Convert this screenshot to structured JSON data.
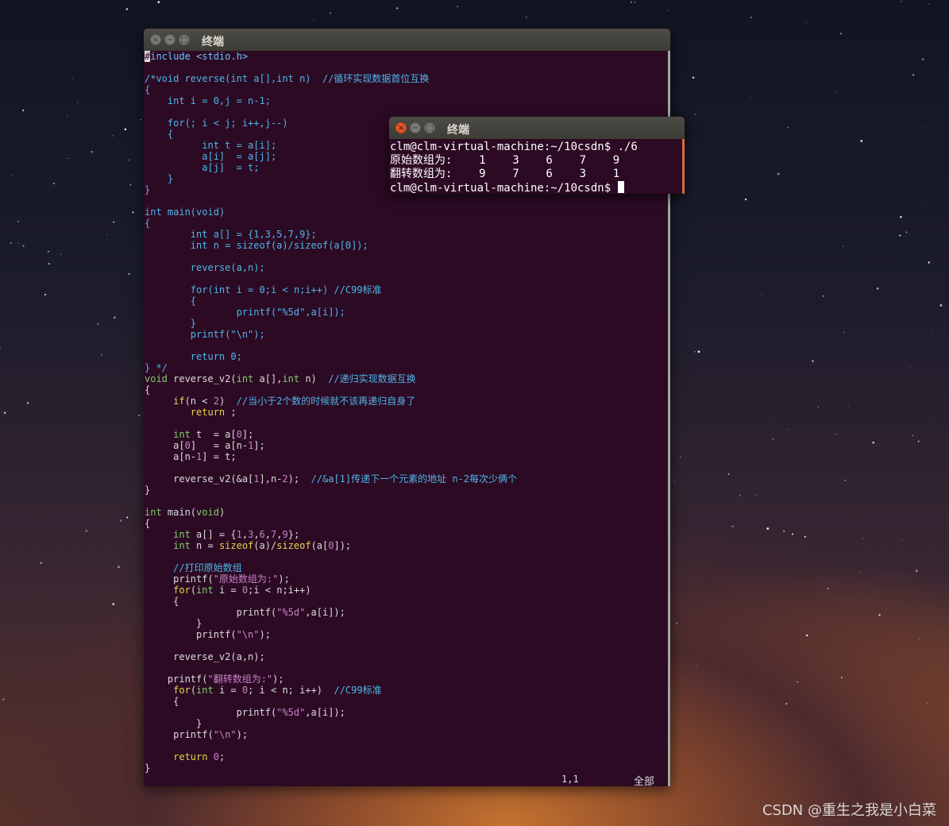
{
  "vim_window": {
    "title": "终端",
    "code_lines": [
      [
        {
          "t": "#include <stdio.h>",
          "c": "#66c2ff"
        }
      ],
      [],
      [
        {
          "t": "/*void reverse(int a[],int n)  //循环实现数据首位互换",
          "c": "#4fb5e8"
        }
      ],
      [
        {
          "t": "{",
          "c": "#4fb5e8"
        }
      ],
      [
        {
          "t": "    int i = 0,j = n-1;",
          "c": "#4fb5e8"
        }
      ],
      [],
      [
        {
          "t": "    for(; i < j; i++,j--)",
          "c": "#4fb5e8"
        }
      ],
      [
        {
          "t": "    {",
          "c": "#4fb5e8"
        }
      ],
      [
        {
          "t": "          int t = a[i];",
          "c": "#4fb5e8"
        }
      ],
      [
        {
          "t": "          a[i]  = a[j];",
          "c": "#4fb5e8"
        }
      ],
      [
        {
          "t": "          a[j]  = t;",
          "c": "#4fb5e8"
        }
      ],
      [
        {
          "t": "    }",
          "c": "#4fb5e8"
        }
      ],
      [
        {
          "t": "}",
          "c": "#4fb5e8"
        }
      ],
      [],
      [
        {
          "t": "int main(void)",
          "c": "#4fb5e8"
        }
      ],
      [
        {
          "t": "{",
          "c": "#4fb5e8"
        }
      ],
      [
        {
          "t": "        int a[] = {1,3,5,7,9};",
          "c": "#4fb5e8"
        }
      ],
      [
        {
          "t": "        int n = sizeof(a)/sizeof(a[0]);",
          "c": "#4fb5e8"
        }
      ],
      [],
      [
        {
          "t": "        reverse(a,n);",
          "c": "#4fb5e8"
        }
      ],
      [],
      [
        {
          "t": "        for(int i = 0;i < n;i++) //C99标准",
          "c": "#4fb5e8"
        }
      ],
      [
        {
          "t": "        {",
          "c": "#4fb5e8"
        }
      ],
      [
        {
          "t": "                printf(\"%5d\",a[i]);",
          "c": "#4fb5e8"
        }
      ],
      [
        {
          "t": "        }",
          "c": "#4fb5e8"
        }
      ],
      [
        {
          "t": "        printf(\"\\n\");",
          "c": "#4fb5e8"
        }
      ],
      [],
      [
        {
          "t": "        return 0;",
          "c": "#4fb5e8"
        }
      ],
      [
        {
          "t": "} */",
          "c": "#4fb5e8"
        }
      ],
      [
        {
          "t": "void ",
          "c": "#7fcf6a"
        },
        {
          "t": "reverse_v2(",
          "c": "#dcdcdc"
        },
        {
          "t": "int",
          "c": "#7fcf6a"
        },
        {
          "t": " a[],",
          "c": "#dcdcdc"
        },
        {
          "t": "int",
          "c": "#7fcf6a"
        },
        {
          "t": " n)  ",
          "c": "#dcdcdc"
        },
        {
          "t": "//递归实现数据互换",
          "c": "#4fb5e8"
        }
      ],
      [
        {
          "t": "{",
          "c": "#dcdcdc"
        }
      ],
      [
        {
          "t": "     ",
          "c": "#dcdcdc"
        },
        {
          "t": "if",
          "c": "#e8d44d"
        },
        {
          "t": "(n < ",
          "c": "#dcdcdc"
        },
        {
          "t": "2",
          "c": "#c783c7"
        },
        {
          "t": ")  ",
          "c": "#dcdcdc"
        },
        {
          "t": "//当小于2个数的时候就不该再递归自身了",
          "c": "#4fb5e8"
        }
      ],
      [
        {
          "t": "        ",
          "c": "#dcdcdc"
        },
        {
          "t": "return",
          "c": "#e8d44d"
        },
        {
          "t": " ;",
          "c": "#dcdcdc"
        }
      ],
      [],
      [
        {
          "t": "     ",
          "c": "#dcdcdc"
        },
        {
          "t": "int",
          "c": "#7fcf6a"
        },
        {
          "t": " t  = a[",
          "c": "#dcdcdc"
        },
        {
          "t": "0",
          "c": "#c783c7"
        },
        {
          "t": "];",
          "c": "#dcdcdc"
        }
      ],
      [
        {
          "t": "     a[",
          "c": "#dcdcdc"
        },
        {
          "t": "0",
          "c": "#c783c7"
        },
        {
          "t": "]   = a[n-",
          "c": "#dcdcdc"
        },
        {
          "t": "1",
          "c": "#c783c7"
        },
        {
          "t": "];",
          "c": "#dcdcdc"
        }
      ],
      [
        {
          "t": "     a[n-",
          "c": "#dcdcdc"
        },
        {
          "t": "1",
          "c": "#c783c7"
        },
        {
          "t": "] = t;",
          "c": "#dcdcdc"
        }
      ],
      [],
      [
        {
          "t": "     reverse_v2(&a[",
          "c": "#dcdcdc"
        },
        {
          "t": "1",
          "c": "#c783c7"
        },
        {
          "t": "],n-",
          "c": "#dcdcdc"
        },
        {
          "t": "2",
          "c": "#c783c7"
        },
        {
          "t": ");  ",
          "c": "#dcdcdc"
        },
        {
          "t": "//&a[1]传递下一个元素的地址 n-2每次少俩个",
          "c": "#4fb5e8"
        }
      ],
      [
        {
          "t": "}",
          "c": "#dcdcdc"
        }
      ],
      [],
      [
        {
          "t": "int",
          "c": "#7fcf6a"
        },
        {
          "t": " main(",
          "c": "#dcdcdc"
        },
        {
          "t": "void",
          "c": "#7fcf6a"
        },
        {
          "t": ")",
          "c": "#dcdcdc"
        }
      ],
      [
        {
          "t": "{",
          "c": "#dcdcdc"
        }
      ],
      [
        {
          "t": "     ",
          "c": "#dcdcdc"
        },
        {
          "t": "int",
          "c": "#7fcf6a"
        },
        {
          "t": " a[] = {",
          "c": "#dcdcdc"
        },
        {
          "t": "1",
          "c": "#c783c7"
        },
        {
          "t": ",",
          "c": "#dcdcdc"
        },
        {
          "t": "3",
          "c": "#c783c7"
        },
        {
          "t": ",",
          "c": "#dcdcdc"
        },
        {
          "t": "6",
          "c": "#c783c7"
        },
        {
          "t": ",",
          "c": "#dcdcdc"
        },
        {
          "t": "7",
          "c": "#c783c7"
        },
        {
          "t": ",",
          "c": "#dcdcdc"
        },
        {
          "t": "9",
          "c": "#c783c7"
        },
        {
          "t": "};",
          "c": "#dcdcdc"
        }
      ],
      [
        {
          "t": "     ",
          "c": "#dcdcdc"
        },
        {
          "t": "int",
          "c": "#7fcf6a"
        },
        {
          "t": " n = ",
          "c": "#dcdcdc"
        },
        {
          "t": "sizeof",
          "c": "#e8d44d"
        },
        {
          "t": "(a)/",
          "c": "#dcdcdc"
        },
        {
          "t": "sizeof",
          "c": "#e8d44d"
        },
        {
          "t": "(a[",
          "c": "#dcdcdc"
        },
        {
          "t": "0",
          "c": "#c783c7"
        },
        {
          "t": "]);",
          "c": "#dcdcdc"
        }
      ],
      [],
      [
        {
          "t": "     ",
          "c": "#dcdcdc"
        },
        {
          "t": "//打印原始数组",
          "c": "#4fb5e8"
        }
      ],
      [
        {
          "t": "     printf(",
          "c": "#dcdcdc"
        },
        {
          "t": "\"原始数组为:\"",
          "c": "#c783c7"
        },
        {
          "t": ");",
          "c": "#dcdcdc"
        }
      ],
      [
        {
          "t": "     ",
          "c": "#dcdcdc"
        },
        {
          "t": "for",
          "c": "#e8d44d"
        },
        {
          "t": "(",
          "c": "#dcdcdc"
        },
        {
          "t": "int",
          "c": "#7fcf6a"
        },
        {
          "t": " i = ",
          "c": "#dcdcdc"
        },
        {
          "t": "0",
          "c": "#c783c7"
        },
        {
          "t": ";i < n;i++)",
          "c": "#dcdcdc"
        }
      ],
      [
        {
          "t": "     {",
          "c": "#dcdcdc"
        }
      ],
      [
        {
          "t": "                printf(",
          "c": "#dcdcdc"
        },
        {
          "t": "\"%5d\"",
          "c": "#c783c7"
        },
        {
          "t": ",a[i]);",
          "c": "#dcdcdc"
        }
      ],
      [
        {
          "t": "         }",
          "c": "#dcdcdc"
        }
      ],
      [
        {
          "t": "         printf(",
          "c": "#dcdcdc"
        },
        {
          "t": "\"\\n\"",
          "c": "#c783c7"
        },
        {
          "t": ");",
          "c": "#dcdcdc"
        }
      ],
      [],
      [
        {
          "t": "     reverse_v2(a,n);",
          "c": "#dcdcdc"
        }
      ],
      [],
      [
        {
          "t": "    printf(",
          "c": "#dcdcdc"
        },
        {
          "t": "\"翻转数组为:\"",
          "c": "#c783c7"
        },
        {
          "t": ");",
          "c": "#dcdcdc"
        }
      ],
      [
        {
          "t": "     ",
          "c": "#dcdcdc"
        },
        {
          "t": "for",
          "c": "#e8d44d"
        },
        {
          "t": "(",
          "c": "#dcdcdc"
        },
        {
          "t": "int",
          "c": "#7fcf6a"
        },
        {
          "t": " i = ",
          "c": "#dcdcdc"
        },
        {
          "t": "0",
          "c": "#c783c7"
        },
        {
          "t": "; i < n; i++)  ",
          "c": "#dcdcdc"
        },
        {
          "t": "//C99标准",
          "c": "#4fb5e8"
        }
      ],
      [
        {
          "t": "     {",
          "c": "#dcdcdc"
        }
      ],
      [
        {
          "t": "                printf(",
          "c": "#dcdcdc"
        },
        {
          "t": "\"%5d\"",
          "c": "#c783c7"
        },
        {
          "t": ",a[i]);",
          "c": "#dcdcdc"
        }
      ],
      [
        {
          "t": "         }",
          "c": "#dcdcdc"
        }
      ],
      [
        {
          "t": "     printf(",
          "c": "#dcdcdc"
        },
        {
          "t": "\"\\n\"",
          "c": "#c783c7"
        },
        {
          "t": ");",
          "c": "#dcdcdc"
        }
      ],
      [],
      [
        {
          "t": "     ",
          "c": "#dcdcdc"
        },
        {
          "t": "return",
          "c": "#e8d44d"
        },
        {
          "t": " ",
          "c": "#dcdcdc"
        },
        {
          "t": "0",
          "c": "#c783c7"
        },
        {
          "t": ";",
          "c": "#dcdcdc"
        }
      ],
      [
        {
          "t": "}",
          "c": "#dcdcdc"
        }
      ]
    ],
    "status_position": "1,1",
    "status_scroll": "全部"
  },
  "terminal_window": {
    "title": "终端",
    "lines": [
      "clm@clm-virtual-machine:~/10csdn$ ./6",
      "原始数组为:    1    3    6    7    9",
      "翻转数组为:    9    7    6    3    1"
    ],
    "prompt": "clm@clm-virtual-machine:~/10csdn$ "
  },
  "watermark": "CSDN @重生之我是小白菜",
  "colors": {
    "terminal_bg": "#2c0a24",
    "comment": "#4fb5e8",
    "type_keyword": "#7fcf6a",
    "statement_keyword": "#e8d44d",
    "constant": "#c783c7",
    "text": "#dcdcdc"
  }
}
